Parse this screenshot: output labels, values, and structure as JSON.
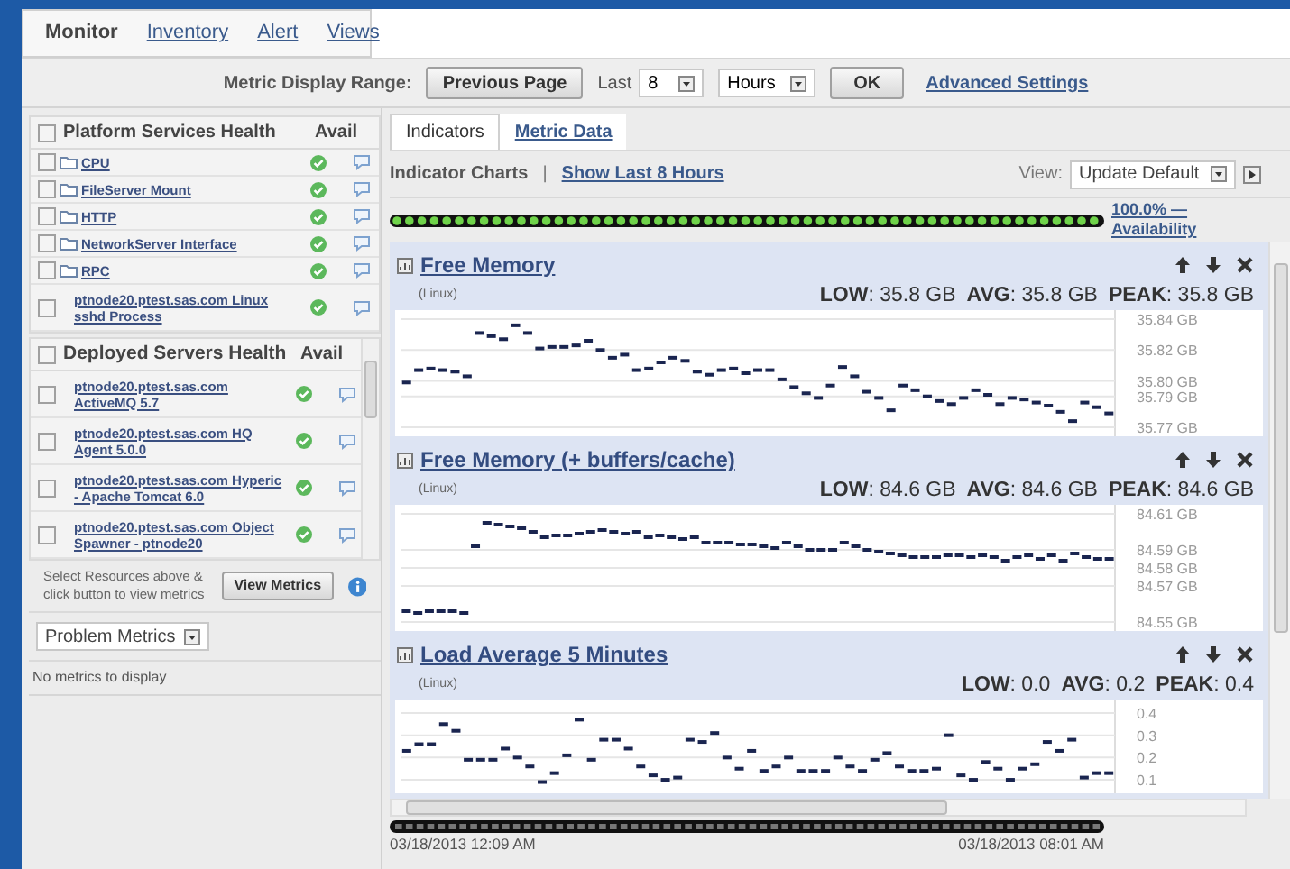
{
  "nav_tabs": [
    {
      "label": "Monitor",
      "selected": true
    },
    {
      "label": "Inventory",
      "selected": false
    },
    {
      "label": "Alert",
      "selected": false
    },
    {
      "label": "Views",
      "selected": false
    }
  ],
  "range_bar": {
    "label": "Metric Display Range:",
    "previous_button": "Previous Page",
    "last_label": "Last",
    "count": "8",
    "unit": "Hours",
    "ok_button": "OK",
    "advanced_link": "Advanced Settings"
  },
  "platform_services": {
    "title": "Platform Services Health",
    "checked": false,
    "avail_heading": "Avail",
    "rows": [
      {
        "kind": "folder",
        "name": "CPU",
        "checked": false,
        "available": true
      },
      {
        "kind": "folder",
        "name": "FileServer Mount",
        "checked": false,
        "available": true
      },
      {
        "kind": "folder",
        "name": "HTTP",
        "checked": false,
        "available": true
      },
      {
        "kind": "folder",
        "name": "NetworkServer Interface",
        "checked": false,
        "available": true
      },
      {
        "kind": "folder",
        "name": "RPC",
        "checked": false,
        "available": true
      },
      {
        "kind": "resource",
        "name": "ptnode20.ptest.sas.com Linux sshd Process",
        "checked": false,
        "available": true
      }
    ]
  },
  "deployed_servers": {
    "title": "Deployed Servers Health",
    "checked": false,
    "avail_heading": "Avail",
    "rows": [
      {
        "kind": "resource",
        "name": "ptnode20.ptest.sas.com ActiveMQ 5.7",
        "checked": false,
        "available": true
      },
      {
        "kind": "resource",
        "name": "ptnode20.ptest.sas.com HQ Agent 5.0.0",
        "checked": false,
        "available": true
      },
      {
        "kind": "resource",
        "name": "ptnode20.ptest.sas.com Hyperic - Apache Tomcat 6.0",
        "checked": false,
        "available": true
      },
      {
        "kind": "resource",
        "name": "ptnode20.ptest.sas.com Object Spawner - ptnode20",
        "checked": false,
        "available": true
      }
    ]
  },
  "view_metrics": {
    "hint": "Select Resources above & click button to view metrics",
    "button": "View Metrics"
  },
  "problem_metrics": {
    "value": "Problem Metrics",
    "message": "No metrics to display"
  },
  "content_tabs": [
    {
      "label": "Indicators",
      "selected": true
    },
    {
      "label": "Metric Data",
      "selected": false
    }
  ],
  "toolbar": {
    "title": "Indicator Charts",
    "separator": "|",
    "link": "Show Last 8 Hours",
    "view_label": "View:",
    "view_value": "Update Default"
  },
  "availability": {
    "link": "100.0% — Availability"
  },
  "charts": [
    {
      "title": "Free Memory",
      "source": "(Linux)",
      "stats": [
        "**LOW**: 35.8 GB",
        "**AVG**: 35.8 GB",
        "**PEAK**: 35.8 GB"
      ],
      "chart_data": {
        "type": "scatter",
        "grid": true,
        "ylim": [
          35.77,
          35.84
        ],
        "yticks": [
          {
            "value": 35.84,
            "label": "35.84 GB"
          },
          {
            "value": 35.82,
            "label": "35.82 GB"
          },
          {
            "value": 35.8,
            "label": "35.80 GB"
          },
          {
            "value": 35.79,
            "label": "35.79 GB"
          },
          {
            "value": 35.77,
            "label": "35.77 GB"
          }
        ],
        "series": [
          {
            "color": "#1a2550",
            "values": [
              35.799,
              35.807,
              35.808,
              35.807,
              35.806,
              35.803,
              35.831,
              35.829,
              35.827,
              35.836,
              35.831,
              35.821,
              35.822,
              35.822,
              35.823,
              35.826,
              35.82,
              35.815,
              35.817,
              35.807,
              35.808,
              35.812,
              35.815,
              35.813,
              35.806,
              35.804,
              35.807,
              35.808,
              35.805,
              35.807,
              35.807,
              35.801,
              35.796,
              35.792,
              35.789,
              35.797,
              35.809,
              35.803,
              35.793,
              35.789,
              35.781,
              35.797,
              35.794,
              35.79,
              35.787,
              35.785,
              35.789,
              35.794,
              35.791,
              35.785,
              35.789,
              35.788,
              35.786,
              35.784,
              35.78,
              35.774,
              35.786,
              35.783,
              35.779
            ]
          }
        ]
      }
    },
    {
      "title": "Free Memory (+ buffers/cache)",
      "source": "(Linux)",
      "stats": [
        "**LOW**: 84.6 GB",
        "**AVG**: 84.6 GB",
        "**PEAK**: 84.6 GB"
      ],
      "chart_data": {
        "type": "scatter",
        "grid": true,
        "ylim": [
          84.55,
          84.61
        ],
        "yticks": [
          {
            "value": 84.61,
            "label": "84.61 GB"
          },
          {
            "value": 84.59,
            "label": "84.59 GB"
          },
          {
            "value": 84.58,
            "label": "84.58 GB"
          },
          {
            "value": 84.57,
            "label": "84.57 GB"
          },
          {
            "value": 84.55,
            "label": "84.55 GB"
          }
        ],
        "series": [
          {
            "color": "#1a2550",
            "values": [
              84.556,
              84.555,
              84.556,
              84.556,
              84.556,
              84.555,
              84.592,
              84.605,
              84.604,
              84.603,
              84.602,
              84.6,
              84.597,
              84.598,
              84.598,
              84.599,
              84.6,
              84.601,
              84.6,
              84.599,
              84.6,
              84.597,
              84.598,
              84.597,
              84.596,
              84.597,
              84.594,
              84.594,
              84.594,
              84.593,
              84.593,
              84.592,
              84.591,
              84.594,
              84.592,
              84.59,
              84.59,
              84.59,
              84.594,
              84.592,
              84.59,
              84.589,
              84.588,
              84.587,
              84.586,
              84.586,
              84.586,
              84.587,
              84.587,
              84.586,
              84.587,
              84.586,
              84.584,
              84.586,
              84.587,
              84.585,
              84.587,
              84.584,
              84.588,
              84.586,
              84.585,
              84.585
            ]
          }
        ]
      }
    },
    {
      "title": "Load Average 5 Minutes",
      "source": "(Linux)",
      "stats": [
        "**LOW**: 0.0",
        "**AVG**: 0.2",
        "**PEAK**: 0.4"
      ],
      "chart_data": {
        "type": "scatter",
        "grid": true,
        "ylim": [
          0.08,
          0.42
        ],
        "yticks": [
          {
            "value": 0.4,
            "label": "0.4"
          },
          {
            "value": 0.3,
            "label": "0.3"
          },
          {
            "value": 0.2,
            "label": "0.2"
          },
          {
            "value": 0.1,
            "label": "0.1"
          }
        ],
        "series": [
          {
            "color": "#1a2550",
            "values": [
              0.23,
              0.26,
              0.26,
              0.35,
              0.32,
              0.19,
              0.19,
              0.19,
              0.24,
              0.2,
              0.16,
              0.09,
              0.13,
              0.21,
              0.37,
              0.19,
              0.28,
              0.28,
              0.24,
              0.16,
              0.12,
              0.1,
              0.11,
              0.28,
              0.27,
              0.31,
              0.2,
              0.15,
              0.23,
              0.14,
              0.16,
              0.2,
              0.14,
              0.14,
              0.14,
              0.2,
              0.16,
              0.14,
              0.19,
              0.22,
              0.16,
              0.14,
              0.14,
              0.15,
              0.3,
              0.12,
              0.1,
              0.18,
              0.15,
              0.1,
              0.15,
              0.17,
              0.27,
              0.23,
              0.28,
              0.11,
              0.13,
              0.13
            ]
          }
        ]
      }
    }
  ],
  "timeline": {
    "start": "03/18/2013 12:09 AM",
    "end": "03/18/2013 08:01 AM"
  }
}
